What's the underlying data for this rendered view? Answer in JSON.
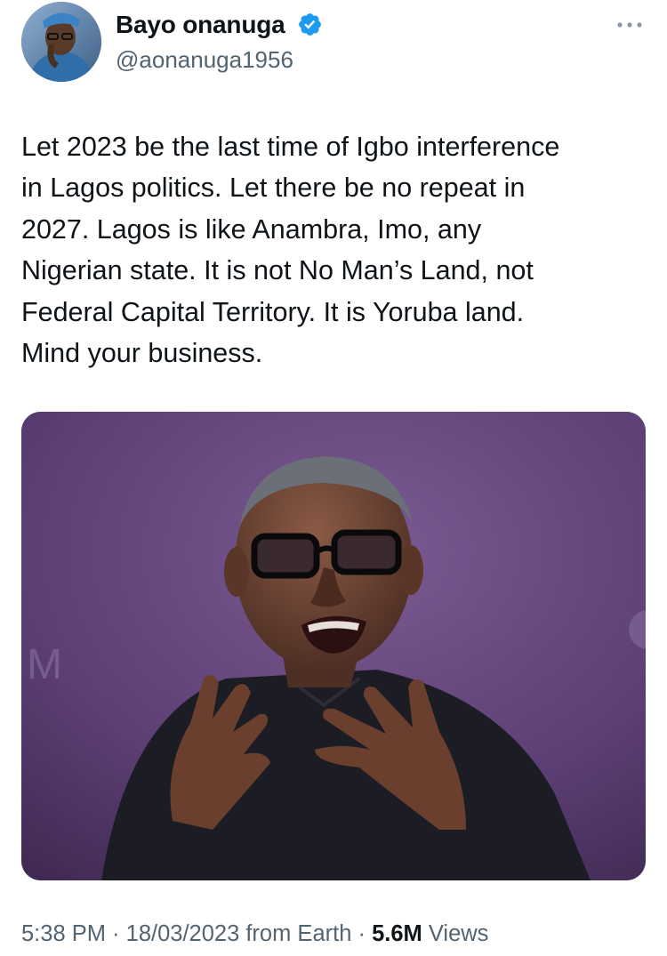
{
  "author": {
    "name": "Bayo onanuga",
    "handle": "@aonanuga1956",
    "verified": true,
    "verified_icon": "verified-badge-icon",
    "verified_color": "#1d9bf0"
  },
  "menu": {
    "icon": "more-options-icon"
  },
  "tweet": {
    "text": "Let 2023 be the last time of Igbo interference\nin Lagos politics. Let there be no repeat in\n2027. Lagos is like Anambra, Imo, any\nNigerian state. It is not No Man’s Land, not\nFederal Capital Territory. It is Yoruba land.\nMind your business."
  },
  "footer": {
    "time": "5:38 PM",
    "separator1": " · ",
    "date": "18/03/2023",
    "source": " from Earth",
    "separator2": " · ",
    "views_count": "5.6M",
    "views_label": " Views"
  },
  "colors": {
    "text_primary": "#0f1419",
    "text_secondary": "#536471",
    "photo_background": "#5b3f72"
  }
}
